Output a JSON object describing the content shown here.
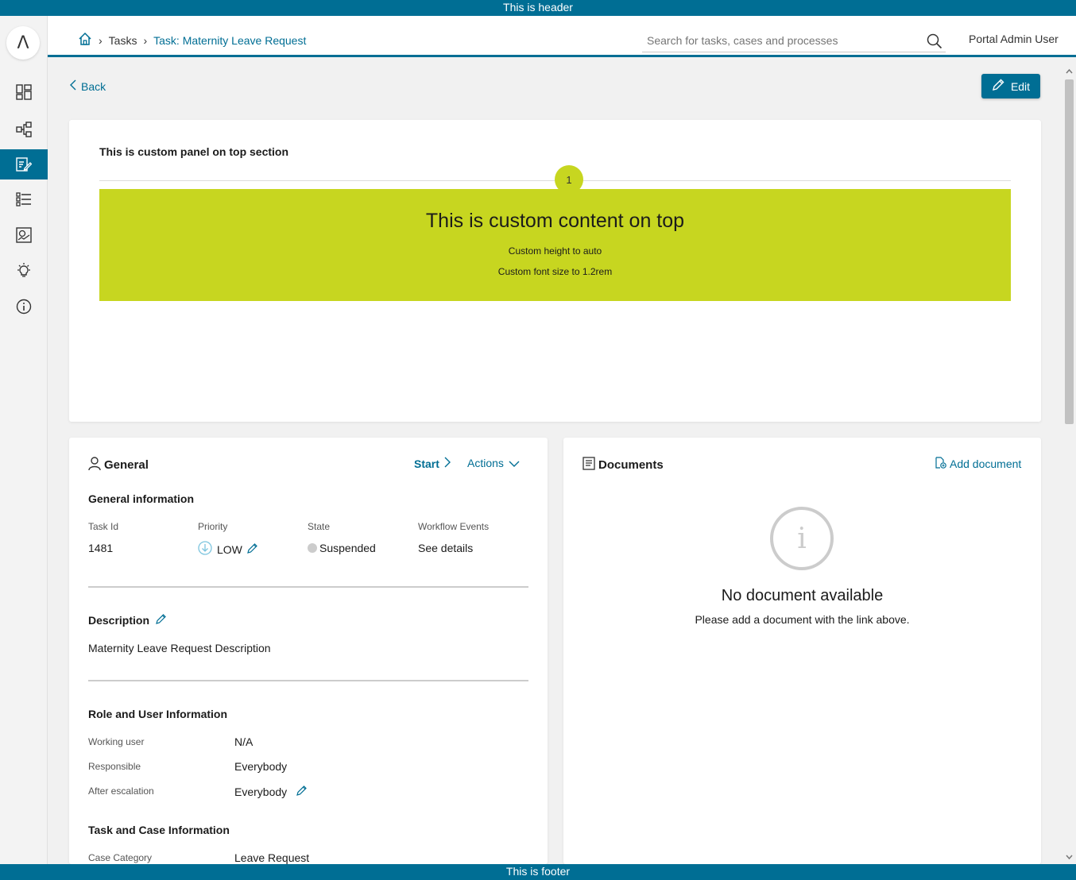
{
  "header_text": "This is header",
  "footer_text": "This is footer",
  "logo": "Λ",
  "sidebar": {
    "items": [
      {
        "icon": "dashboard-icon"
      },
      {
        "icon": "process-icon"
      },
      {
        "icon": "task-icon",
        "active": true
      },
      {
        "icon": "case-list-icon"
      },
      {
        "icon": "statistics-icon"
      },
      {
        "icon": "idea-icon"
      },
      {
        "icon": "info-icon"
      }
    ]
  },
  "breadcrumb": {
    "tasks": "Tasks",
    "current": "Task: Maternity Leave Request"
  },
  "search": {
    "placeholder": "Search for tasks, cases and processes"
  },
  "user": {
    "name": "Portal Admin User"
  },
  "back_label": "Back",
  "edit_label": "Edit",
  "top_panel": {
    "title": "This is custom panel on top section",
    "badge": "1",
    "content_title": "This is custom content on top",
    "line1": "Custom height to auto",
    "line2": "Custom font size to 1.2rem"
  },
  "general": {
    "title": "General",
    "start_label": "Start",
    "actions_label": "Actions",
    "info_title": "General information",
    "task_id_label": "Task Id",
    "task_id": "1481",
    "priority_label": "Priority",
    "priority": "LOW",
    "state_label": "State",
    "state": "Suspended",
    "workflow_label": "Workflow Events",
    "workflow_link": "See details",
    "description_title": "Description",
    "description": "Maternity Leave Request Description",
    "role_title": "Role and User Information",
    "working_user_label": "Working user",
    "working_user": "N/A",
    "responsible_label": "Responsible",
    "responsible": "Everybody",
    "after_escalation_label": "After escalation",
    "after_escalation": "Everybody",
    "task_case_title": "Task and Case Information",
    "case_category_label": "Case Category",
    "case_category": "Leave Request"
  },
  "documents": {
    "title": "Documents",
    "add_label": "Add document",
    "empty_title": "No document available",
    "empty_text": "Please add a document with the link above."
  },
  "colors": {
    "brand": "#006e94",
    "accent_green": "#c7d620"
  }
}
